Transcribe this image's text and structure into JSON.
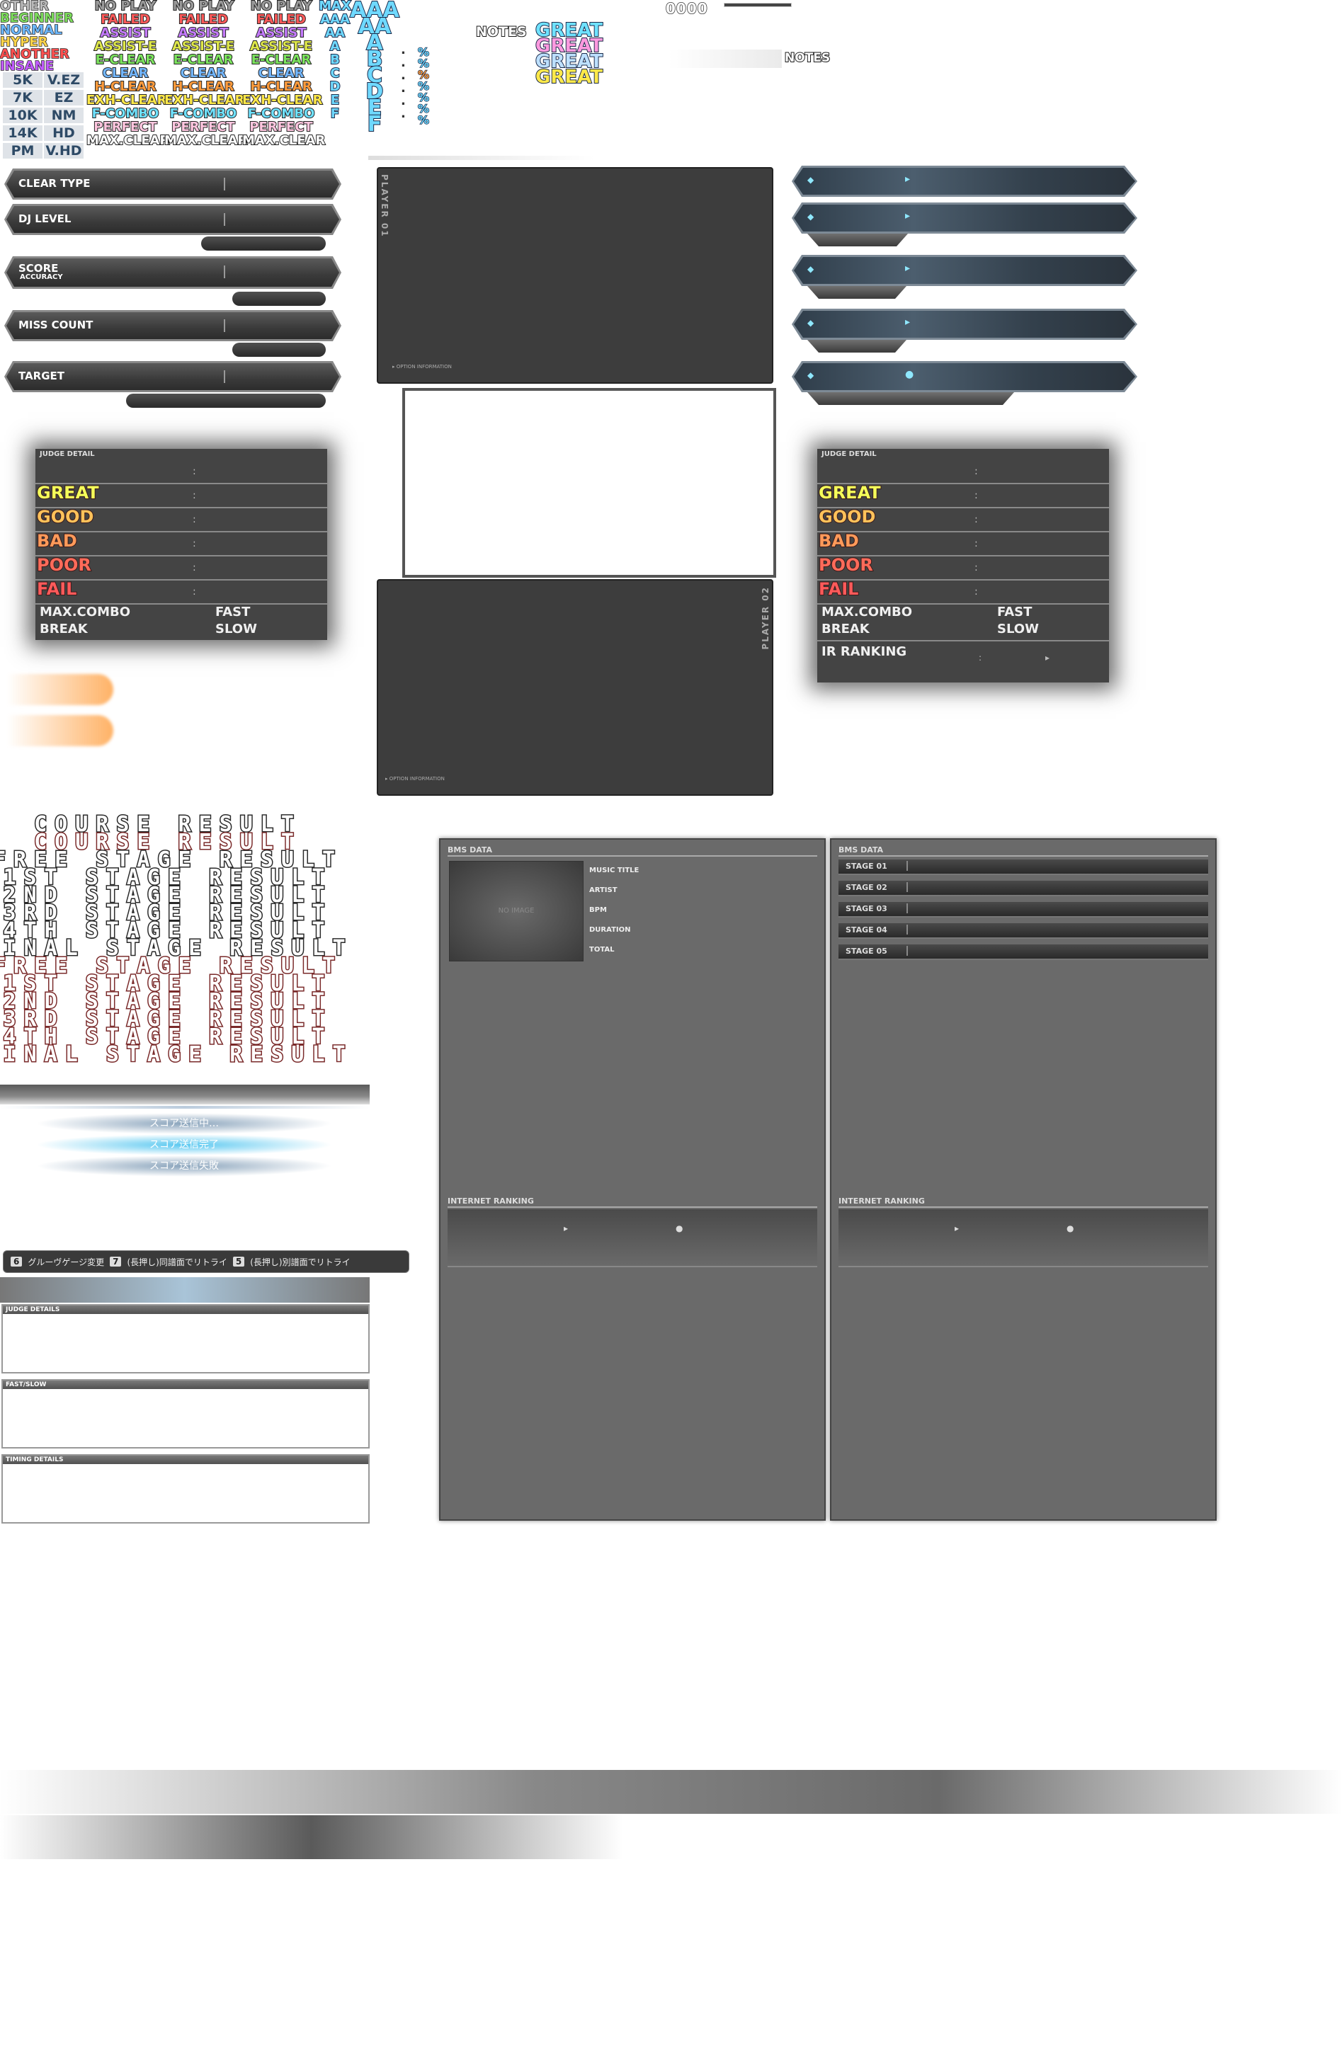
{
  "difficulty_labels": [
    {
      "text": "OTHER",
      "color": "#b9b9b9"
    },
    {
      "text": "BEGINNER",
      "color": "#7ddc5c"
    },
    {
      "text": "NORMAL",
      "color": "#6cb8ff"
    },
    {
      "text": "HYPER",
      "color": "#ffd54a"
    },
    {
      "text": "ANOTHER",
      "color": "#ff5050"
    },
    {
      "text": "INSANE",
      "color": "#c25cff"
    }
  ],
  "key_modes": [
    "5K",
    "7K",
    "10K",
    "14K",
    "PM"
  ],
  "gauge_modes": [
    "V.EZ",
    "EZ",
    "NM",
    "HD",
    "V.HD"
  ],
  "clear_types": [
    {
      "text": "NO PLAY",
      "color": "#9a9a9a"
    },
    {
      "text": "FAILED",
      "color": "#ff5a5a"
    },
    {
      "text": "ASSIST",
      "color": "#c57bff"
    },
    {
      "text": "ASSIST-E",
      "color": "#dfe84a"
    },
    {
      "text": "E-CLEAR",
      "color": "#7ce45e"
    },
    {
      "text": "CLEAR",
      "color": "#73b7ff"
    },
    {
      "text": "H-CLEAR",
      "color": "#ff9b3c"
    },
    {
      "text": "EXH-CLEAR",
      "color": "#ffe94a"
    },
    {
      "text": "F-COMBO",
      "color": "#6fe2ff"
    },
    {
      "text": "PERFECT",
      "color": "#ffc6df"
    },
    {
      "text": "MAX.CLEAR",
      "color": "#ffffff"
    }
  ],
  "small_ranks": [
    "MAX",
    "AAA",
    "AA",
    "A",
    "B",
    "C",
    "D",
    "E",
    "F"
  ],
  "big_ranks": [
    "AAA",
    "AA",
    "A",
    "B",
    "C",
    "D",
    "E",
    "F"
  ],
  "percent_glyphs": [
    "%",
    "%",
    "%",
    "%",
    "%",
    "%",
    "%"
  ],
  "percent_dots": [
    ".",
    ".",
    ".",
    ".",
    ".",
    "."
  ],
  "notes_label": "NOTES",
  "great_labels": [
    "GREAT",
    "GREAT",
    "GREAT",
    "GREAT"
  ],
  "digit_strip": "0000",
  "notes_label_2": "NOTES",
  "left_bars": {
    "clear_type": "CLEAR TYPE",
    "dj_level": "DJ LEVEL",
    "score": "SCORE",
    "accuracy": "ACCURACY",
    "miss_count": "MISS COUNT",
    "target": "TARGET"
  },
  "player1": {
    "label": "PLAYER 01",
    "option": "▸ OPTION INFORMATION"
  },
  "player2": {
    "label": "PLAYER 02",
    "option": "▸ OPTION INFORMATION"
  },
  "judge_left": {
    "header": "JUDGE DETAIL",
    "rows": [
      {
        "name": "GREAT",
        "color": "#f5ff5a"
      },
      {
        "name": "GOOD",
        "color": "#ffc25a"
      },
      {
        "name": "BAD",
        "color": "#ff9a5a"
      },
      {
        "name": "POOR",
        "color": "#ff6b5a"
      },
      {
        "name": "FAIL",
        "color": "#ff5a5a"
      }
    ],
    "max_combo": "MAX.COMBO",
    "break": "BREAK",
    "fast": "FAST",
    "slow": "SLOW"
  },
  "judge_right": {
    "header": "JUDGE DETAIL",
    "rows": [
      {
        "name": "GREAT",
        "color": "#f5ff5a"
      },
      {
        "name": "GOOD",
        "color": "#ffc25a"
      },
      {
        "name": "BAD",
        "color": "#ff9a5a"
      },
      {
        "name": "POOR",
        "color": "#ff6b5a"
      },
      {
        "name": "FAIL",
        "color": "#ff5a5a"
      }
    ],
    "max_combo": "MAX.COMBO",
    "break": "BREAK",
    "fast": "FAST",
    "slow": "SLOW",
    "ir_ranking": "IR RANKING"
  },
  "result_titles": [
    {
      "text": "COURSE RESULT",
      "style": "dark"
    },
    {
      "text": "COURSE RESULT",
      "style": "red"
    },
    {
      "text": "FREE STAGE RESULT",
      "style": "dark"
    },
    {
      "text": "1ST STAGE RESULT",
      "style": "dark"
    },
    {
      "text": "2ND STAGE RESULT",
      "style": "dark"
    },
    {
      "text": "3RD STAGE RESULT",
      "style": "dark"
    },
    {
      "text": "4TH STAGE RESULT",
      "style": "dark"
    },
    {
      "text": "FINAL STAGE RESULT",
      "style": "dark"
    },
    {
      "text": "FREE STAGE RESULT",
      "style": "red"
    },
    {
      "text": "1ST STAGE RESULT",
      "style": "red"
    },
    {
      "text": "2ND STAGE RESULT",
      "style": "red"
    },
    {
      "text": "3RD STAGE RESULT",
      "style": "red"
    },
    {
      "text": "4TH STAGE RESULT",
      "style": "red"
    },
    {
      "text": "FINAL STAGE RESULT",
      "style": "red"
    }
  ],
  "ir_status": [
    "スコア送信中…",
    "スコア送信完了",
    "スコア送信失敗"
  ],
  "key_hints": [
    {
      "key": "6",
      "text": "グルーヴゲージ変更"
    },
    {
      "key": "7",
      "text": "(長押し)同譜面でリトライ"
    },
    {
      "key": "5",
      "text": "(長押し)別譜面でリトライ"
    }
  ],
  "detail_boxes": [
    "JUDGE DETAILS",
    "FAST/SLOW",
    "TIMING DETAILS"
  ],
  "bms_left": {
    "header": "BMS DATA",
    "no_image": "NO IMAGE",
    "fields": [
      "MUSIC TITLE",
      "ARTIST",
      "BPM",
      "DURATION",
      "TOTAL"
    ],
    "ranking": "INTERNET RANKING"
  },
  "bms_right": {
    "header": "BMS DATA",
    "stages": [
      "STAGE 01",
      "STAGE 02",
      "STAGE 03",
      "STAGE 04",
      "STAGE 05"
    ],
    "ranking": "INTERNET RANKING"
  }
}
